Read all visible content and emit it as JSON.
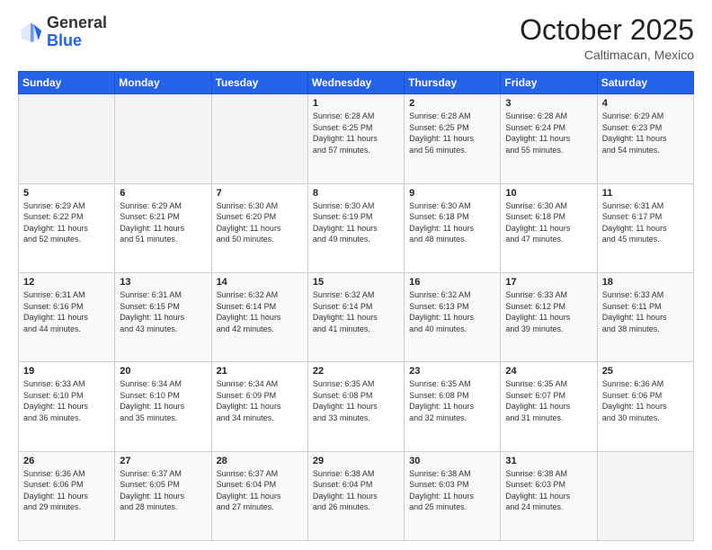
{
  "header": {
    "logo_line1": "General",
    "logo_line2": "Blue",
    "month": "October 2025",
    "location": "Caltimacan, Mexico"
  },
  "weekdays": [
    "Sunday",
    "Monday",
    "Tuesday",
    "Wednesday",
    "Thursday",
    "Friday",
    "Saturday"
  ],
  "weeks": [
    [
      {
        "day": "",
        "info": ""
      },
      {
        "day": "",
        "info": ""
      },
      {
        "day": "",
        "info": ""
      },
      {
        "day": "1",
        "info": "Sunrise: 6:28 AM\nSunset: 6:25 PM\nDaylight: 11 hours\nand 57 minutes."
      },
      {
        "day": "2",
        "info": "Sunrise: 6:28 AM\nSunset: 6:25 PM\nDaylight: 11 hours\nand 56 minutes."
      },
      {
        "day": "3",
        "info": "Sunrise: 6:28 AM\nSunset: 6:24 PM\nDaylight: 11 hours\nand 55 minutes."
      },
      {
        "day": "4",
        "info": "Sunrise: 6:29 AM\nSunset: 6:23 PM\nDaylight: 11 hours\nand 54 minutes."
      }
    ],
    [
      {
        "day": "5",
        "info": "Sunrise: 6:29 AM\nSunset: 6:22 PM\nDaylight: 11 hours\nand 52 minutes."
      },
      {
        "day": "6",
        "info": "Sunrise: 6:29 AM\nSunset: 6:21 PM\nDaylight: 11 hours\nand 51 minutes."
      },
      {
        "day": "7",
        "info": "Sunrise: 6:30 AM\nSunset: 6:20 PM\nDaylight: 11 hours\nand 50 minutes."
      },
      {
        "day": "8",
        "info": "Sunrise: 6:30 AM\nSunset: 6:19 PM\nDaylight: 11 hours\nand 49 minutes."
      },
      {
        "day": "9",
        "info": "Sunrise: 6:30 AM\nSunset: 6:18 PM\nDaylight: 11 hours\nand 48 minutes."
      },
      {
        "day": "10",
        "info": "Sunrise: 6:30 AM\nSunset: 6:18 PM\nDaylight: 11 hours\nand 47 minutes."
      },
      {
        "day": "11",
        "info": "Sunrise: 6:31 AM\nSunset: 6:17 PM\nDaylight: 11 hours\nand 45 minutes."
      }
    ],
    [
      {
        "day": "12",
        "info": "Sunrise: 6:31 AM\nSunset: 6:16 PM\nDaylight: 11 hours\nand 44 minutes."
      },
      {
        "day": "13",
        "info": "Sunrise: 6:31 AM\nSunset: 6:15 PM\nDaylight: 11 hours\nand 43 minutes."
      },
      {
        "day": "14",
        "info": "Sunrise: 6:32 AM\nSunset: 6:14 PM\nDaylight: 11 hours\nand 42 minutes."
      },
      {
        "day": "15",
        "info": "Sunrise: 6:32 AM\nSunset: 6:14 PM\nDaylight: 11 hours\nand 41 minutes."
      },
      {
        "day": "16",
        "info": "Sunrise: 6:32 AM\nSunset: 6:13 PM\nDaylight: 11 hours\nand 40 minutes."
      },
      {
        "day": "17",
        "info": "Sunrise: 6:33 AM\nSunset: 6:12 PM\nDaylight: 11 hours\nand 39 minutes."
      },
      {
        "day": "18",
        "info": "Sunrise: 6:33 AM\nSunset: 6:11 PM\nDaylight: 11 hours\nand 38 minutes."
      }
    ],
    [
      {
        "day": "19",
        "info": "Sunrise: 6:33 AM\nSunset: 6:10 PM\nDaylight: 11 hours\nand 36 minutes."
      },
      {
        "day": "20",
        "info": "Sunrise: 6:34 AM\nSunset: 6:10 PM\nDaylight: 11 hours\nand 35 minutes."
      },
      {
        "day": "21",
        "info": "Sunrise: 6:34 AM\nSunset: 6:09 PM\nDaylight: 11 hours\nand 34 minutes."
      },
      {
        "day": "22",
        "info": "Sunrise: 6:35 AM\nSunset: 6:08 PM\nDaylight: 11 hours\nand 33 minutes."
      },
      {
        "day": "23",
        "info": "Sunrise: 6:35 AM\nSunset: 6:08 PM\nDaylight: 11 hours\nand 32 minutes."
      },
      {
        "day": "24",
        "info": "Sunrise: 6:35 AM\nSunset: 6:07 PM\nDaylight: 11 hours\nand 31 minutes."
      },
      {
        "day": "25",
        "info": "Sunrise: 6:36 AM\nSunset: 6:06 PM\nDaylight: 11 hours\nand 30 minutes."
      }
    ],
    [
      {
        "day": "26",
        "info": "Sunrise: 6:36 AM\nSunset: 6:06 PM\nDaylight: 11 hours\nand 29 minutes."
      },
      {
        "day": "27",
        "info": "Sunrise: 6:37 AM\nSunset: 6:05 PM\nDaylight: 11 hours\nand 28 minutes."
      },
      {
        "day": "28",
        "info": "Sunrise: 6:37 AM\nSunset: 6:04 PM\nDaylight: 11 hours\nand 27 minutes."
      },
      {
        "day": "29",
        "info": "Sunrise: 6:38 AM\nSunset: 6:04 PM\nDaylight: 11 hours\nand 26 minutes."
      },
      {
        "day": "30",
        "info": "Sunrise: 6:38 AM\nSunset: 6:03 PM\nDaylight: 11 hours\nand 25 minutes."
      },
      {
        "day": "31",
        "info": "Sunrise: 6:38 AM\nSunset: 6:03 PM\nDaylight: 11 hours\nand 24 minutes."
      },
      {
        "day": "",
        "info": ""
      }
    ]
  ]
}
